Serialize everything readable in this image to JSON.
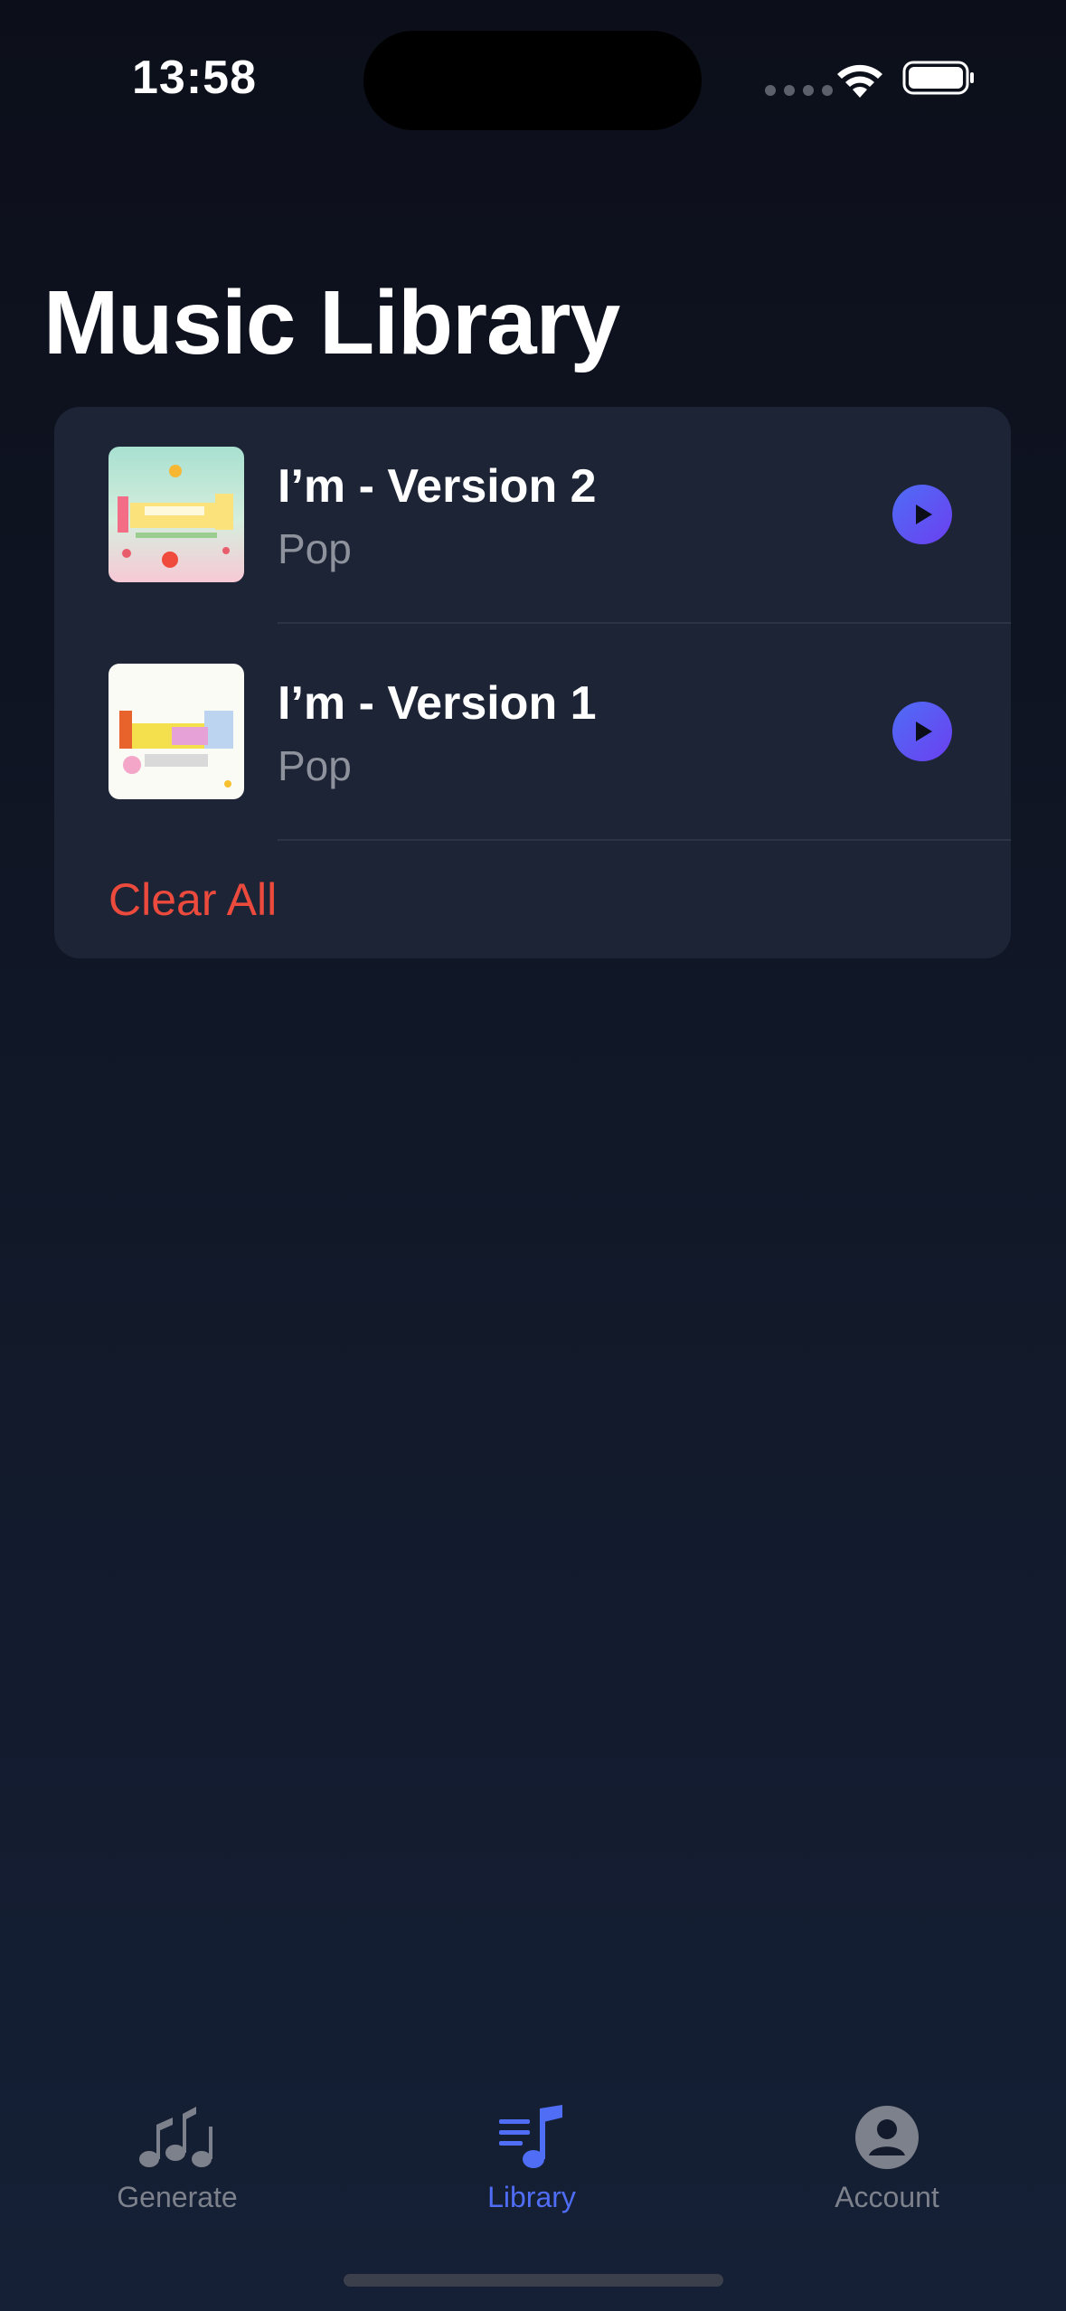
{
  "status_bar": {
    "time": "13:58"
  },
  "page": {
    "title": "Music Library"
  },
  "library": {
    "songs": [
      {
        "title": "I’m - Version 2",
        "genre": "Pop"
      },
      {
        "title": "I’m - Version 1",
        "genre": "Pop"
      }
    ],
    "clear_all_label": "Clear All"
  },
  "tab_bar": {
    "items": [
      {
        "label": "Generate",
        "icon": "music-notes-icon",
        "active": false
      },
      {
        "label": "Library",
        "icon": "music-list-icon",
        "active": true
      },
      {
        "label": "Account",
        "icon": "person-circle-icon",
        "active": false
      }
    ]
  },
  "colors": {
    "background": "#0c0f1a",
    "card": "#1c2436",
    "accent": "#4f6df5",
    "destructive": "#ec4a3c",
    "secondary_text": "#8e929c",
    "inactive_tab": "#7d818b"
  }
}
